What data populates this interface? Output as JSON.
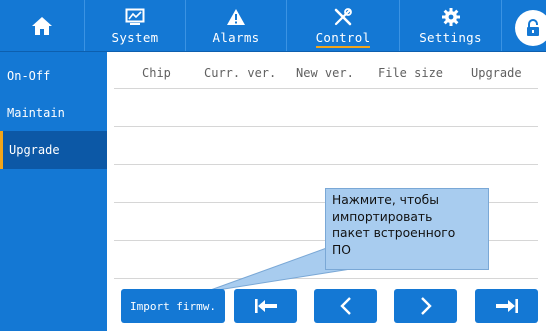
{
  "colors": {
    "primary": "#1478d4",
    "active_side": "#0c58a6",
    "accent": "#f2a51a",
    "tooltip_bg": "#a8ccef"
  },
  "topbar": {
    "home_icon": "home-icon",
    "tabs": [
      {
        "label": "System",
        "icon": "monitor-chart-icon"
      },
      {
        "label": "Alarms",
        "icon": "warning-icon"
      },
      {
        "label": "Control",
        "icon": "tools-icon",
        "active": true
      },
      {
        "label": "Settings",
        "icon": "gear-icon"
      }
    ],
    "lock_icon": "lock-icon"
  },
  "sidebar": {
    "items": [
      {
        "label": "On-Off"
      },
      {
        "label": "Maintain"
      },
      {
        "label": "Upgrade",
        "active": true
      }
    ]
  },
  "table": {
    "columns": [
      "Chip",
      "Curr. ver.",
      "New ver.",
      "File size",
      "Upgrade"
    ],
    "rows": []
  },
  "tooltip": {
    "lines": [
      "Нажмите, чтобы",
      "импортировать",
      "пакет встроенного",
      "ПО"
    ]
  },
  "toolbar": {
    "import_label": "Import firmw.",
    "first_icon": "first-page-icon",
    "prev_icon": "prev-page-icon",
    "next_icon": "next-page-icon",
    "last_icon": "last-page-icon"
  }
}
